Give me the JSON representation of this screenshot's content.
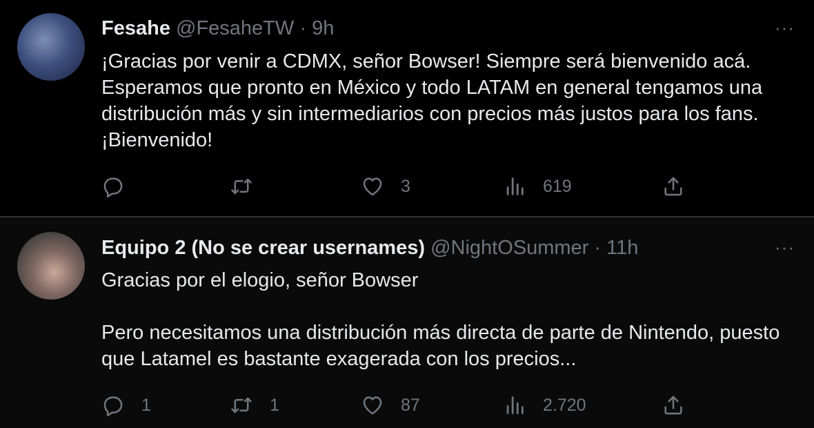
{
  "tweets": [
    {
      "name": "Fesahe",
      "handle": "@FesaheTW",
      "separator": "·",
      "time": "9h",
      "text": "¡Gracias por venir a CDMX, señor Bowser! Siempre será bienvenido acá.\nEsperamos que pronto en México y todo LATAM en general tengamos una distribución más y sin intermediarios con precios más justos para los fans. ¡Bienvenido!",
      "more": "···",
      "stats": {
        "replies": "",
        "retweets": "",
        "likes": "3",
        "views": "619"
      }
    },
    {
      "name": "Equipo 2 (No se crear usernames)",
      "handle": "@NightOSummer",
      "separator": "·",
      "time": "11h",
      "text": "Gracias por el elogio, señor Bowser\n\nPero necesitamos una distribución más directa de parte de Nintendo, puesto que Latamel es bastante exagerada con los precios...",
      "more": "···",
      "stats": {
        "replies": "1",
        "retweets": "1",
        "likes": "87",
        "views": "2.720"
      }
    }
  ],
  "icons": {
    "reply": "reply-icon",
    "retweet": "retweet-icon",
    "like": "heart-icon",
    "views": "views-icon",
    "share": "share-icon",
    "more": "more-icon"
  },
  "colors": {
    "background": "#000000",
    "reply_background": "#0a0a0a",
    "text": "#e7e9ea",
    "secondary": "#71767b",
    "divider": "#2f3336"
  }
}
